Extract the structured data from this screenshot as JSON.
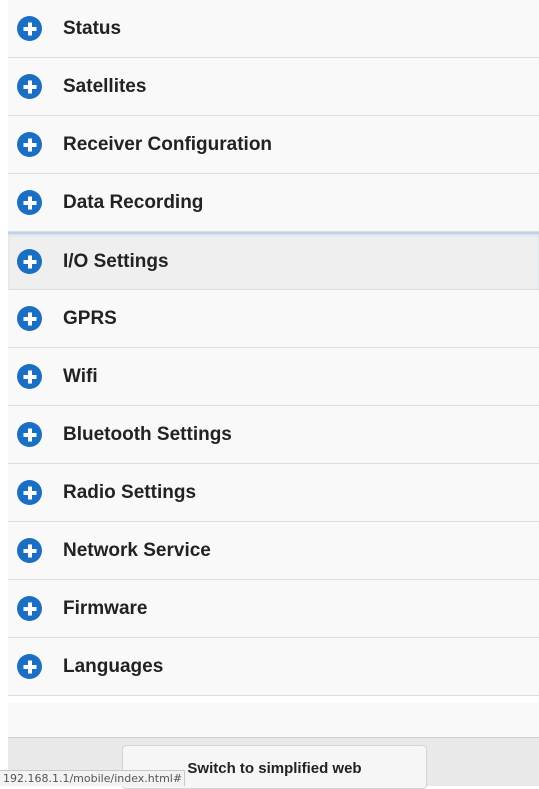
{
  "menu": {
    "items": [
      {
        "label": "Status",
        "icon": "plus-circle-icon"
      },
      {
        "label": "Satellites",
        "icon": "plus-circle-icon"
      },
      {
        "label": "Receiver Configuration",
        "icon": "plus-circle-icon"
      },
      {
        "label": "Data Recording",
        "icon": "plus-circle-icon"
      },
      {
        "label": "I/O Settings",
        "icon": "plus-circle-icon",
        "active": true
      },
      {
        "label": "GPRS",
        "icon": "plus-circle-icon"
      },
      {
        "label": "Wifi",
        "icon": "plus-circle-icon"
      },
      {
        "label": "Bluetooth Settings",
        "icon": "plus-circle-icon"
      },
      {
        "label": "Radio Settings",
        "icon": "plus-circle-icon"
      },
      {
        "label": "Network Service",
        "icon": "plus-circle-icon"
      },
      {
        "label": "Firmware",
        "icon": "plus-circle-icon"
      },
      {
        "label": "Languages",
        "icon": "plus-circle-icon"
      }
    ]
  },
  "footer": {
    "switch_label": "Switch to simplified web"
  },
  "status_bar": {
    "url": "192.168.1.1/mobile/index.html#"
  },
  "colors": {
    "icon_blue": "#1b6fc2",
    "item_background": "#f9f9f9",
    "active_background": "#efefef"
  }
}
